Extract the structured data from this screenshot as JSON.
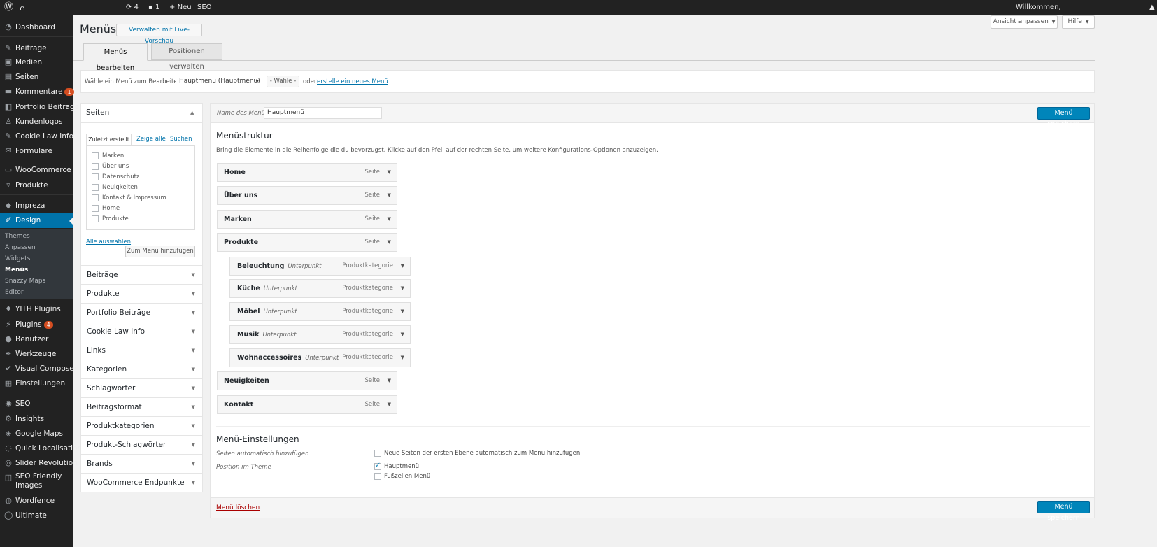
{
  "admin_bar": {
    "updates_count": "4",
    "comments_count": "1",
    "new_label": "Neu",
    "seo_label": "SEO",
    "welcome": "Willkommen,"
  },
  "sidebar": {
    "items": [
      {
        "label": "Dashboard",
        "icon": "dashboard-icon"
      },
      {
        "label": "Beiträge",
        "icon": "pin-icon"
      },
      {
        "label": "Medien",
        "icon": "media-icon"
      },
      {
        "label": "Seiten",
        "icon": "page-icon"
      },
      {
        "label": "Kommentare",
        "icon": "comment-icon",
        "badge": "1"
      },
      {
        "label": "Portfolio Beiträge",
        "icon": "portfolio-icon"
      },
      {
        "label": "Kundenlogos",
        "icon": "person-icon"
      },
      {
        "label": "Cookie Law Info",
        "icon": "pin-icon"
      },
      {
        "label": "Formulare",
        "icon": "mail-icon"
      },
      {
        "label": "WooCommerce",
        "icon": "woocommerce-icon"
      },
      {
        "label": "Produkte",
        "icon": "cart-icon"
      },
      {
        "label": "Impreza",
        "icon": "diamond-icon"
      },
      {
        "label": "Design",
        "icon": "brush-icon"
      },
      {
        "label": "YITH Plugins",
        "icon": "yith-icon"
      },
      {
        "label": "Plugins",
        "icon": "plugin-icon",
        "badge": "4"
      },
      {
        "label": "Benutzer",
        "icon": "user-icon"
      },
      {
        "label": "Werkzeuge",
        "icon": "wrench-icon"
      },
      {
        "label": "Visual Composer",
        "icon": "vc-icon"
      },
      {
        "label": "Einstellungen",
        "icon": "settings-icon"
      },
      {
        "label": "SEO",
        "icon": "seo-icon"
      },
      {
        "label": "Insights",
        "icon": "gear-icon"
      },
      {
        "label": "Google Maps",
        "icon": "map-pin-icon"
      },
      {
        "label": "Quick Localisation",
        "icon": "locale-icon"
      },
      {
        "label": "Slider Revolution",
        "icon": "slider-icon"
      },
      {
        "label": "SEO Friendly Images",
        "icon": "image-seo-icon"
      },
      {
        "label": "Wordfence",
        "icon": "shield-icon"
      },
      {
        "label": "Ultimate",
        "icon": "ultimate-icon"
      }
    ],
    "design_submenu": [
      "Themes",
      "Anpassen",
      "Widgets",
      "Menüs",
      "Snazzy Maps",
      "Editor"
    ]
  },
  "screen_options": "Ansicht anpassen",
  "help": "Hilfe",
  "page": {
    "title": "Menüs",
    "live_preview": "Verwalten mit Live-Vorschau",
    "tabs": [
      "Menüs bearbeiten",
      "Positionen verwalten"
    ]
  },
  "select_bar": {
    "label": "Wähle ein Menü zum Bearbeiten:",
    "selected": "Hauptmenü (Hauptmenü)",
    "select_button": "- Wähle -",
    "or": "oder",
    "create_link": "erstelle ein neues Menü",
    "period": "."
  },
  "pages_panel": {
    "title": "Seiten",
    "tabs": [
      "Zuletzt erstellt",
      "Zeige alle",
      "Suchen"
    ],
    "items": [
      "Marken",
      "Über uns",
      "Datenschutz",
      "Neuigkeiten",
      "Kontakt & Impressum",
      "Home",
      "Produkte"
    ],
    "select_all": "Alle auswählen",
    "add_button": "Zum Menü hinzufügen"
  },
  "accordions": [
    "Beiträge",
    "Produkte",
    "Portfolio Beiträge",
    "Cookie Law Info",
    "Links",
    "Kategorien",
    "Schlagwörter",
    "Beitragsformat",
    "Produktkategorien",
    "Produkt-Schlagwörter",
    "Brands",
    "WooCommerce Endpunkte"
  ],
  "menu_editor": {
    "name_label": "Name des Menüs",
    "name_value": "Hauptmenü",
    "save": "Menü speichern",
    "structure_title": "Menüstruktur",
    "structure_desc": "Bring die Elemente in die Reihenfolge die du bevorzugst. Klicke auf den Pfeil auf der rechten Seite, um weitere Konfigurations-Optionen anzuzeigen.",
    "items": [
      {
        "title": "Home",
        "type": "Seite",
        "sub": ""
      },
      {
        "title": "Über uns",
        "type": "Seite",
        "sub": ""
      },
      {
        "title": "Marken",
        "type": "Seite",
        "sub": ""
      },
      {
        "title": "Produkte",
        "type": "Seite",
        "sub": ""
      },
      {
        "title": "Beleuchtung",
        "type": "Produktkategorie",
        "sub": "Unterpunkt"
      },
      {
        "title": "Küche",
        "type": "Produktkategorie",
        "sub": "Unterpunkt"
      },
      {
        "title": "Möbel",
        "type": "Produktkategorie",
        "sub": "Unterpunkt"
      },
      {
        "title": "Musik",
        "type": "Produktkategorie",
        "sub": "Unterpunkt"
      },
      {
        "title": "Wohnaccessoires",
        "type": "Produktkategorie",
        "sub": "Unterpunkt"
      },
      {
        "title": "Neuigkeiten",
        "type": "Seite",
        "sub": ""
      },
      {
        "title": "Kontakt",
        "type": "Seite",
        "sub": ""
      }
    ],
    "settings_title": "Menü-Einstellungen",
    "auto_add_label": "Seiten automatisch hinzufügen",
    "auto_add_option": "Neue Seiten der ersten Ebene automatisch zum Menü hinzufügen",
    "position_label": "Position im Theme",
    "positions": [
      {
        "label": "Hauptmenü",
        "checked": true
      },
      {
        "label": "Fußzeilen Menü",
        "checked": false
      }
    ],
    "delete": "Menü löschen"
  }
}
